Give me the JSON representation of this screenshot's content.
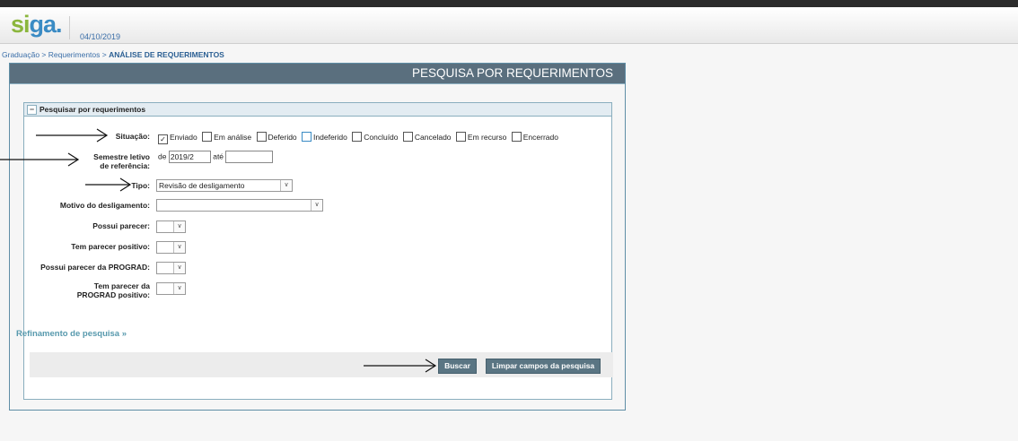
{
  "header": {
    "logo_part1": "si",
    "logo_part2": "ga.",
    "date": "04/10/2019"
  },
  "breadcrumb": {
    "path": "Graduação > Requerimentos > ",
    "current": "ANÁLISE DE REQUERIMENTOS"
  },
  "panel": {
    "title": "PESQUISA POR REQUERIMENTOS",
    "section_title": "Pesquisar por requerimentos"
  },
  "form": {
    "situacao_label": "Situação:",
    "situacao_options": [
      {
        "label": "Enviado",
        "checked": true
      },
      {
        "label": "Em análise",
        "checked": false
      },
      {
        "label": "Deferido",
        "checked": false
      },
      {
        "label": "Indeferido",
        "checked": false
      },
      {
        "label": "Concluído",
        "checked": false
      },
      {
        "label": "Cancelado",
        "checked": false
      },
      {
        "label": "Em recurso",
        "checked": false
      },
      {
        "label": "Encerrado",
        "checked": false
      }
    ],
    "semestre_label": "Semestre letivo de referência:",
    "semestre_de": "de",
    "semestre_from_value": "2019/2",
    "semestre_ate": "até",
    "semestre_to_value": "",
    "tipo_label": "Tipo:",
    "tipo_value": "Revisão de desligamento",
    "motivo_label": "Motivo do desligamento:",
    "motivo_value": "",
    "possui_parecer_label": "Possui parecer:",
    "tem_parecer_positivo_label": "Tem parecer positivo:",
    "possui_parecer_prograd_label": "Possui parecer da PROGRAD:",
    "tem_parecer_prograd_positivo_label": "Tem parecer da PROGRAD positivo:"
  },
  "refine_label": "Refinamento de pesquisa",
  "buttons": {
    "search": "Buscar",
    "clear": "Limpar campos da pesquisa"
  },
  "colors": {
    "panel_title_bg": "#5a6f7e",
    "button_bg": "#5a7583",
    "link": "#3a6ea8"
  }
}
